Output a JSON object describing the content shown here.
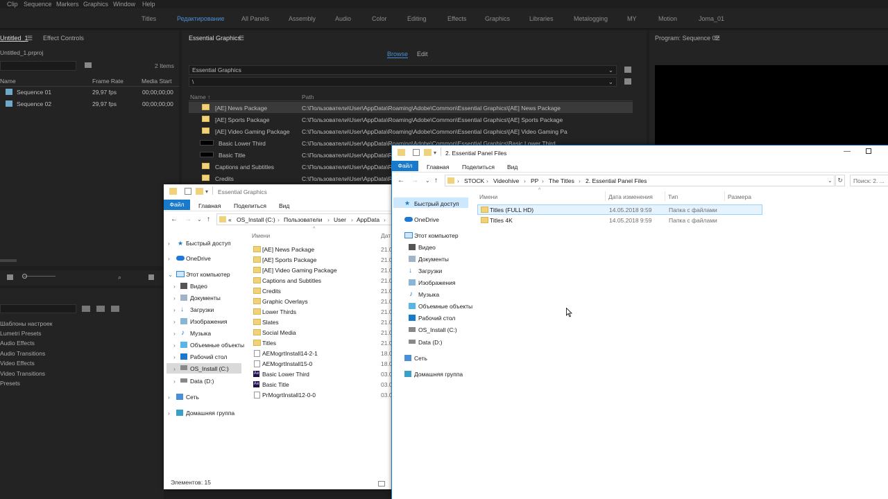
{
  "menubar": [
    "Clip",
    "Sequence",
    "Markers",
    "Graphics",
    "Window",
    "Help"
  ],
  "workspaces": [
    "Titles",
    "Редактирование",
    "All Panels",
    "Assembly",
    "Audio",
    "Color",
    "Editing",
    "Effects",
    "Graphics",
    "Libraries",
    "Metalogging",
    "MY",
    "Motion",
    "Joma_01"
  ],
  "project": {
    "tab1": "Untitled_1",
    "tab2": "Effect Controls",
    "file": "Untitled_1.prproj",
    "items_count": "2 Items",
    "col_name": "Name",
    "col_fps": "Frame Rate",
    "col_start": "Media Start",
    "rows": [
      {
        "name": "Sequence 01",
        "fps": "29,97 fps",
        "start": "00;00;00;00"
      },
      {
        "name": "Sequence 02",
        "fps": "29,97 fps",
        "start": "00;00;00;00"
      }
    ]
  },
  "effects": {
    "items": [
      "Шаблоны настроек",
      "Lumetri Presets",
      "Audio Effects",
      "Audio Transitions",
      "Video Effects",
      "Video Transitions",
      "Presets"
    ]
  },
  "eg": {
    "title": "Essential Graphics",
    "tab_browse": "Browse",
    "tab_edit": "Edit",
    "dropdown": "Essential Graphics",
    "path_field": "\\",
    "col_name": "Name",
    "col_path": "Path",
    "rows": [
      {
        "name": "[AE] News Package",
        "path": "C:\\Пользователи\\User\\AppData\\Roaming\\Adobe\\Common\\Essential Graphics\\[AE] News Package"
      },
      {
        "name": "[AE] Sports Package",
        "path": "C:\\Пользователи\\User\\AppData\\Roaming\\Adobe\\Common\\Essential Graphics\\[AE] Sports Package"
      },
      {
        "name": "[AE] Video Gaming Package",
        "path": "C:\\Пользователи\\User\\AppData\\Roaming\\Adobe\\Common\\Essential Graphics\\[AE] Video Gaming Pa"
      },
      {
        "name": "Basic Lower Third",
        "path": "C:\\Пользователи\\User\\AppData\\Roaming\\Adobe\\Common\\Essential Graphics\\Basic Lower Third"
      },
      {
        "name": "Basic Title",
        "path": "C:\\Пользователи\\User\\AppData\\Ro"
      },
      {
        "name": "Captions and Subtitles",
        "path": "C:\\Пользователи\\User\\AppData\\Ro"
      },
      {
        "name": "Credits",
        "path": "C:\\Пользователи\\User\\AppData\\Ro"
      }
    ]
  },
  "program": {
    "title": "Program: Sequence 02"
  },
  "exp1": {
    "title": "Essential Graphics",
    "ribbon": [
      "Файл",
      "Главная",
      "Поделиться",
      "Вид"
    ],
    "crumbs": [
      "«",
      "OS_Install (C:)",
      "Пользователи",
      "User",
      "AppData"
    ],
    "col_name": "Имени",
    "col_date": "Дат",
    "nav": [
      "Быстрый доступ",
      "OneDrive",
      "Этот компьютер",
      "Видео",
      "Документы",
      "Загрузки",
      "Изображения",
      "Музыка",
      "Объемные объекты",
      "Рабочий стол",
      "OS_Install (C:)",
      "Data (D:)",
      "Сеть",
      "Домашняя группа"
    ],
    "files": [
      {
        "name": "[AE] News Package",
        "date": "21.0",
        "t": "f"
      },
      {
        "name": "[AE] Sports Package",
        "date": "21.0",
        "t": "f"
      },
      {
        "name": "[AE] Video Gaming Package",
        "date": "21.0",
        "t": "f"
      },
      {
        "name": "Captions and Subtitles",
        "date": "21.0",
        "t": "f"
      },
      {
        "name": "Credits",
        "date": "21.0",
        "t": "f"
      },
      {
        "name": "Graphic Overlays",
        "date": "21.0",
        "t": "f"
      },
      {
        "name": "Lower Thirds",
        "date": "21.0",
        "t": "f"
      },
      {
        "name": "Slates",
        "date": "21.0",
        "t": "f"
      },
      {
        "name": "Social Media",
        "date": "21.0",
        "t": "f"
      },
      {
        "name": "Titles",
        "date": "21.0",
        "t": "f"
      },
      {
        "name": "AEMogrtInstall14-2-1",
        "date": "18.0",
        "t": "d"
      },
      {
        "name": "AEMogrtInstall15-0",
        "date": "18.0",
        "t": "d"
      },
      {
        "name": "Basic Lower Third",
        "date": "03.0",
        "t": "a"
      },
      {
        "name": "Basic Title",
        "date": "03.0",
        "t": "a"
      },
      {
        "name": "PrMogrtInstall12-0-0",
        "date": "03.0",
        "t": "d"
      }
    ],
    "status": "Элементов: 15"
  },
  "exp2": {
    "title": "2. Essential Panel Files",
    "ribbon": [
      "Файл",
      "Главная",
      "Поделиться",
      "Вид"
    ],
    "crumbs": [
      "STOCK",
      "Videohive",
      "PP",
      "The Titles",
      "2. Essential Panel Files"
    ],
    "search": "Поиск: 2. ...",
    "cols": [
      "Имени",
      "Дата изменения",
      "Тип",
      "Размера"
    ],
    "nav": [
      "Быстрый доступ",
      "OneDrive",
      "Этот компьютер",
      "Видео",
      "Документы",
      "Загрузки",
      "Изображения",
      "Музыка",
      "Объемные объекты",
      "Рабочий стол",
      "OS_Install (C:)",
      "Data (D:)",
      "Сеть",
      "Домашняя группа"
    ],
    "files": [
      {
        "name": "Titles (FULL HD)",
        "date": "14.05.2018 9:59",
        "type": "Папка с файлами"
      },
      {
        "name": "Titles 4K",
        "date": "14.05.2018 9:59",
        "type": "Папка с файлами"
      }
    ]
  }
}
